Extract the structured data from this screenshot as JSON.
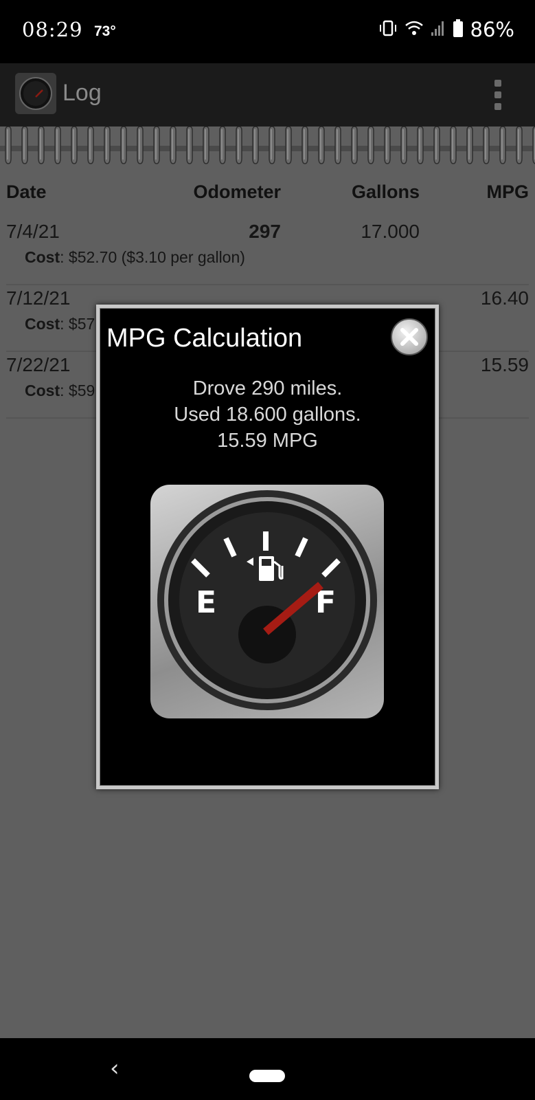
{
  "status_bar": {
    "time": "08:29",
    "temperature": "73°",
    "battery_pct": "86%"
  },
  "app_bar": {
    "title": "Log"
  },
  "table": {
    "headers": {
      "date": "Date",
      "odometer": "Odometer",
      "gallons": "Gallons",
      "mpg": "MPG"
    },
    "rows": [
      {
        "date": "7/4/21",
        "odometer": "297",
        "gallons": "17.000",
        "mpg": "",
        "cost_label": "Cost",
        "cost_value": ": $52.70 ($3.10 per gallon)"
      },
      {
        "date": "7/12/21",
        "odometer": "",
        "gallons": "",
        "mpg": "16.40",
        "cost_label": "Cost",
        "cost_value": ": $57"
      },
      {
        "date": "7/22/21",
        "odometer": "",
        "gallons": "",
        "mpg": "15.59",
        "cost_label": "Cost",
        "cost_value": ": $59"
      }
    ]
  },
  "dialog": {
    "title": "MPG Calculation",
    "line1": "Drove 290 miles.",
    "line2": "Used 18.600 gallons.",
    "line3": "15.59 MPG",
    "gauge": {
      "empty_label": "E",
      "full_label": "F"
    }
  },
  "colors": {
    "accent_needle": "#a51c14",
    "dialog_bg": "#000000",
    "dimmed_bg": "#5f5f5f"
  }
}
